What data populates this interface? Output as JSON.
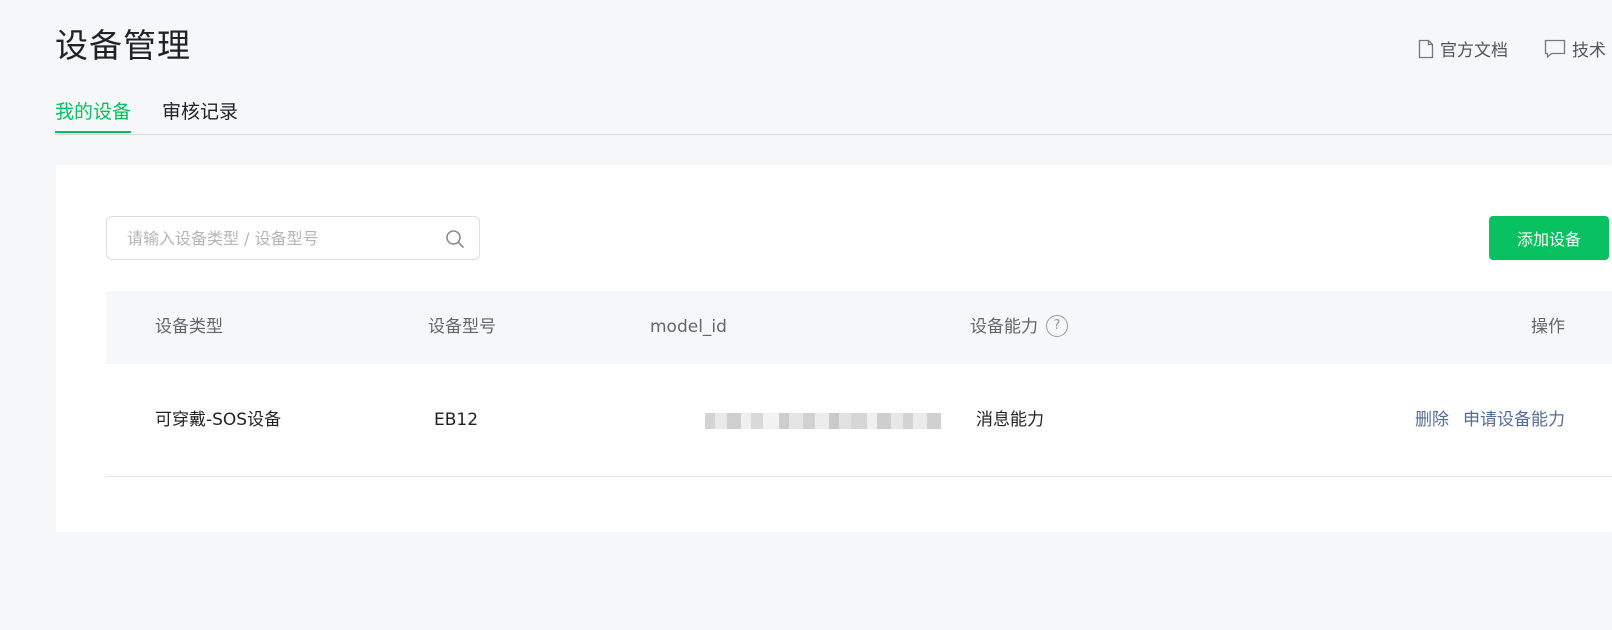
{
  "header": {
    "title": "设备管理",
    "links": [
      "官方文档",
      "技术"
    ]
  },
  "tabs": [
    "我的设备",
    "审核记录"
  ],
  "search": {
    "placeholder": "请输入设备类型 / 设备型号",
    "value": ""
  },
  "add_button": "添加设备",
  "table": {
    "columns": [
      "设备类型",
      "设备型号",
      "model_id",
      "设备能力",
      "操作"
    ],
    "rows": [
      {
        "device_type": "可穿戴-SOS设备",
        "device_model": "EB12",
        "model_id_masked": true,
        "capability": "消息能力",
        "actions": [
          "删除",
          "申请设备能力"
        ]
      }
    ]
  },
  "colors": {
    "accent": "#07c160",
    "link": "#576b95",
    "background": "#f6f7f9"
  }
}
